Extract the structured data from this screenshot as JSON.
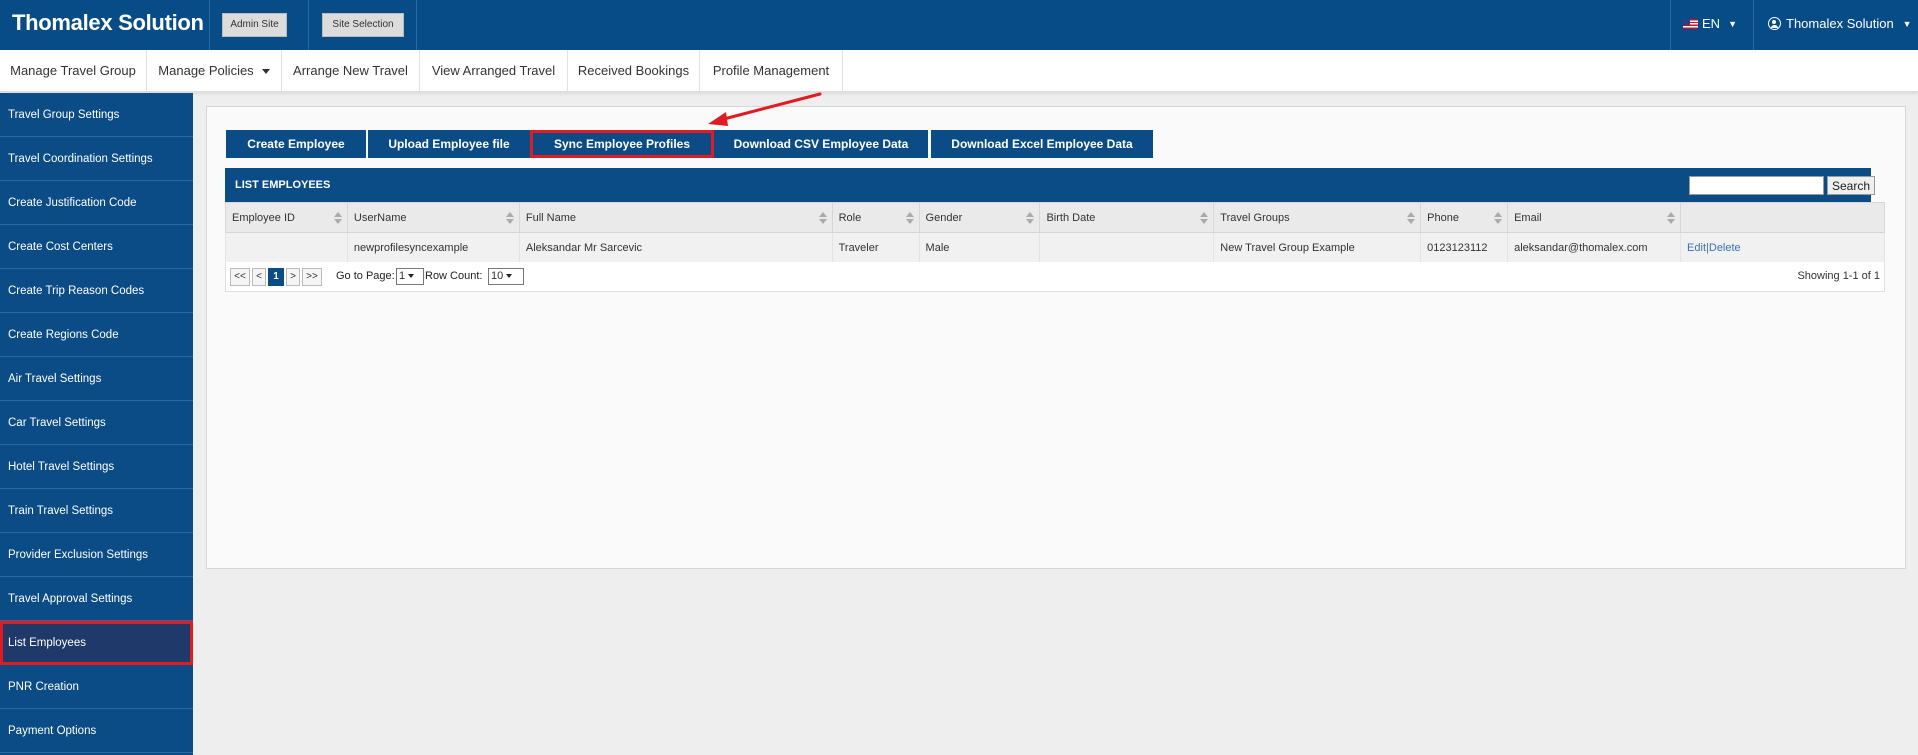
{
  "header": {
    "brand": "Thomalex Solution",
    "admin_site": "Admin Site",
    "site_selection": "Site Selection",
    "language": "EN",
    "user_name": "Thomalex Solution"
  },
  "nav": {
    "items": [
      "Manage Travel Group",
      "Manage Policies",
      "Arrange New Travel",
      "View Arranged Travel",
      "Received Bookings",
      "Profile Management"
    ]
  },
  "sidebar": {
    "items": [
      "Travel Group Settings",
      "Travel Coordination Settings",
      "Create Justification Code",
      "Create Cost Centers",
      "Create Trip Reason Codes",
      "Create Regions Code",
      "Air Travel Settings",
      "Car Travel Settings",
      "Hotel Travel Settings",
      "Train Travel Settings",
      "Provider Exclusion Settings",
      "Travel Approval Settings",
      "List Employees",
      "PNR Creation",
      "Payment Options"
    ],
    "active": "List Employees"
  },
  "actions": {
    "create_employee": "Create Employee",
    "upload_employee_file": "Upload Employee file",
    "sync_employee_profiles": "Sync Employee Profiles",
    "download_csv": "Download CSV Employee Data",
    "download_excel": "Download Excel Employee Data"
  },
  "list": {
    "title": "LIST EMPLOYEES",
    "search_value": "",
    "search_button": "Search",
    "columns": [
      "Employee ID",
      "UserName",
      "Full Name",
      "Role",
      "Gender",
      "Birth Date",
      "Travel Groups",
      "Phone",
      "Email",
      ""
    ],
    "rows": [
      {
        "employee_id": "",
        "username": "newprofilesyncexample",
        "full_name": "Aleksandar Mr Sarcevic",
        "role": "Traveler",
        "gender": "Male",
        "birth_date": "",
        "travel_groups": "New Travel Group Example",
        "phone": "0123123112",
        "email": "aleksandar@thomalex.com",
        "edit": "Edit",
        "separator": "|",
        "delete": "Delete"
      }
    ]
  },
  "pager": {
    "first": "<<",
    "prev": "<",
    "current": "1",
    "next": ">",
    "last": ">>",
    "go_to_page_label": "Go to Page:",
    "go_to_page_value": "1",
    "row_count_label": "Row Count:",
    "row_count_value": "10",
    "showing": "Showing 1-1 of 1"
  },
  "colors": {
    "primary": "#0b4c86",
    "highlight": "#e01b22",
    "sidebar_active": "#1f3a6a"
  }
}
